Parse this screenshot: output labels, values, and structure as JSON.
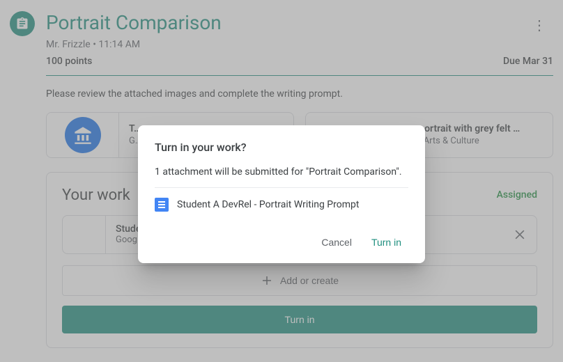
{
  "header": {
    "title": "Portrait Comparison",
    "teacher": "Mr. Frizzle",
    "time": "11:14 AM",
    "points": "100 points",
    "due": "Due Mar 31"
  },
  "description": "Please review the attached images and complete the writing prompt.",
  "attachments": [
    {
      "title": "T…",
      "subtitle": "G…"
    },
    {
      "title": "…ortrait with grey felt …",
      "subtitle": "…Arts & Culture"
    }
  ],
  "work": {
    "heading": "Your work",
    "status": "Assigned",
    "file": {
      "title": "Studer",
      "subtitle": "Google"
    },
    "add_label": "Add or create",
    "turnin_label": "Turn in"
  },
  "dialog": {
    "title": "Turn in your work?",
    "body": "1 attachment will be submitted for \"Portrait Comparison\".",
    "attachment_name": "Student A DevRel - Portrait Writing Prompt",
    "cancel": "Cancel",
    "confirm": "Turn in"
  }
}
